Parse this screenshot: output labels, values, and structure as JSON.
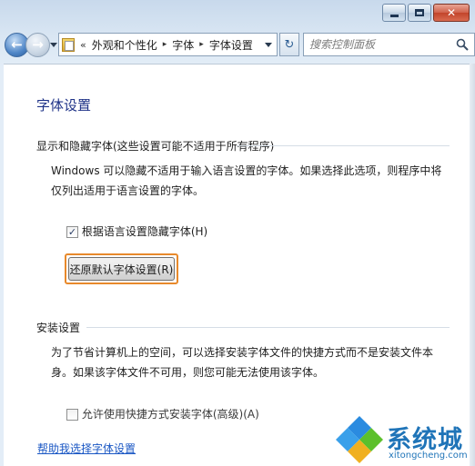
{
  "window": {
    "minimize_glyph": "",
    "maximize_glyph": "",
    "close_glyph": "✕"
  },
  "nav": {
    "back_glyph": "←",
    "forward_glyph": "→",
    "address": {
      "overflow_chevron": "«",
      "crumbs": [
        "外观和个性化",
        "字体",
        "字体设置"
      ],
      "separator": "▸"
    },
    "refresh_glyph": "↻",
    "search_placeholder": "搜索控制面板"
  },
  "page": {
    "title": "字体设置",
    "section_display": {
      "title": "显示和隐藏字体(这些设置可能不适用于所有程序)",
      "description": "Windows 可以隐藏不适用于输入语言设置的字体。如果选择此选项，则程序中将仅列出适用于语言设置的字体。",
      "checkbox_label": "根据语言设置隐藏字体(H)",
      "checkbox_checked": true,
      "reset_button": "还原默认字体设置(R)"
    },
    "section_install": {
      "title": "安装设置",
      "description": "为了节省计算机上的空间，可以选择安装字体文件的快捷方式而不是安装文件本身。如果该字体文件不可用，则您可能无法使用该字体。",
      "checkbox_label": "允许使用快捷方式安装字体(高级)(A)",
      "checkbox_checked": false
    },
    "help_link": "帮助我选择字体设置"
  },
  "watermark": {
    "brand": "系统城",
    "url": "xitongcheng.com"
  },
  "colors": {
    "title_blue": "#1e3287",
    "link_blue": "#1a57c4",
    "focus_orange": "#e8892b",
    "watermark_blue": "#1f74b8"
  }
}
